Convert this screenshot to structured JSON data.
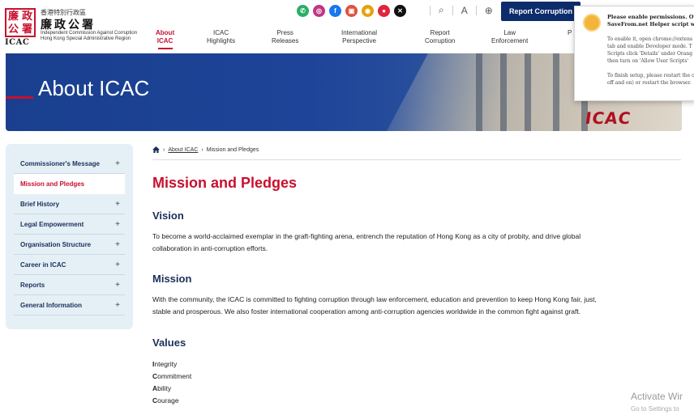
{
  "header": {
    "logo_seal": [
      "廉",
      "政",
      "公",
      "署"
    ],
    "logo_abbr": "ICAC",
    "logo_zh_small": "香港特別行政區",
    "logo_zh_big": "廉政公署",
    "logo_en_1": "Independent Commission Against Corruption",
    "logo_en_2": "Hong Kong Special Administrative Region",
    "report_button": "Report Corruption",
    "social_icons": [
      {
        "name": "wechat-icon",
        "glyph": "✆",
        "color": "#2aae67"
      },
      {
        "name": "instagram-icon",
        "glyph": "◎",
        "color": "#c13584"
      },
      {
        "name": "facebook-icon",
        "glyph": "f",
        "color": "#1877f2"
      },
      {
        "name": "app-icon",
        "glyph": "▣",
        "color": "#e0523b"
      },
      {
        "name": "weibo-icon",
        "glyph": "◉",
        "color": "#e6a10f"
      },
      {
        "name": "rednote-icon",
        "glyph": "●",
        "color": "#e0243c"
      },
      {
        "name": "x-icon",
        "glyph": "✕",
        "color": "#111111"
      }
    ],
    "tool_search": "⌕",
    "tool_font": "A",
    "tool_lang": "⊕"
  },
  "nav": [
    {
      "line1": "About",
      "line2": "ICAC"
    },
    {
      "line1": "ICAC",
      "line2": "Highlights"
    },
    {
      "line1": "Press",
      "line2": "Releases"
    },
    {
      "line1": "International",
      "line2": "Perspective"
    },
    {
      "line1": "Report",
      "line2": "Corruption"
    },
    {
      "line1": "Law",
      "line2": "Enforcement"
    },
    {
      "line1": "P",
      "line2": ""
    }
  ],
  "banner": {
    "title": "About ICAC",
    "sign": "ICAC"
  },
  "popup": {
    "title_1": "Please enable permissions. Othe",
    "title_2": "SaveFrom.net Helper script will",
    "text": [
      "To enable it, open chrome://extens",
      "tab and enable Developer mode. T",
      "Scripts click 'Details' under Orang",
      "then turn on 'Allow User Scripts'",
      "",
      "To finish setup, please restart the c",
      "off and on) or restart the browser."
    ]
  },
  "sidebar": {
    "items": [
      {
        "label": "Commissioner's Message",
        "plus": "+"
      },
      {
        "label": "Mission and Pledges",
        "plus": ""
      },
      {
        "label": "Brief History",
        "plus": "+"
      },
      {
        "label": "Legal Empowerment",
        "plus": "+"
      },
      {
        "label": "Organisation Structure",
        "plus": "+"
      },
      {
        "label": "Career in ICAC",
        "plus": "+"
      },
      {
        "label": "Reports",
        "plus": "+"
      },
      {
        "label": "General Information",
        "plus": "+"
      }
    ]
  },
  "breadcrumb": {
    "sep": "›",
    "about": "About ICAC",
    "current": "Mission and Pledges"
  },
  "main": {
    "title": "Mission and Pledges",
    "vision_heading": "Vision",
    "vision_line1": "To become a world-acclaimed exemplar in the graft-fighting arena, entrench the reputation of Hong Kong as a city of probity, and drive global",
    "vision_line2": "collaboration in anti-corruption efforts.",
    "mission_heading": "Mission",
    "mission_line1": "With the community, the ICAC is committed to fighting corruption through law enforcement, education and prevention to keep Hong Kong fair, just,",
    "mission_line2": "stable and prosperous. We also foster international cooperation among anti-corruption agencies worldwide in the common fight against graft.",
    "values_heading": "Values",
    "values": [
      {
        "first": "I",
        "rest": "ntegrity"
      },
      {
        "first": "C",
        "rest": "ommitment"
      },
      {
        "first": "A",
        "rest": "bility"
      },
      {
        "first": "C",
        "rest": "ourage"
      }
    ]
  },
  "watermark": {
    "line1": "Activate Wir",
    "line2": "Go to Settings to"
  }
}
